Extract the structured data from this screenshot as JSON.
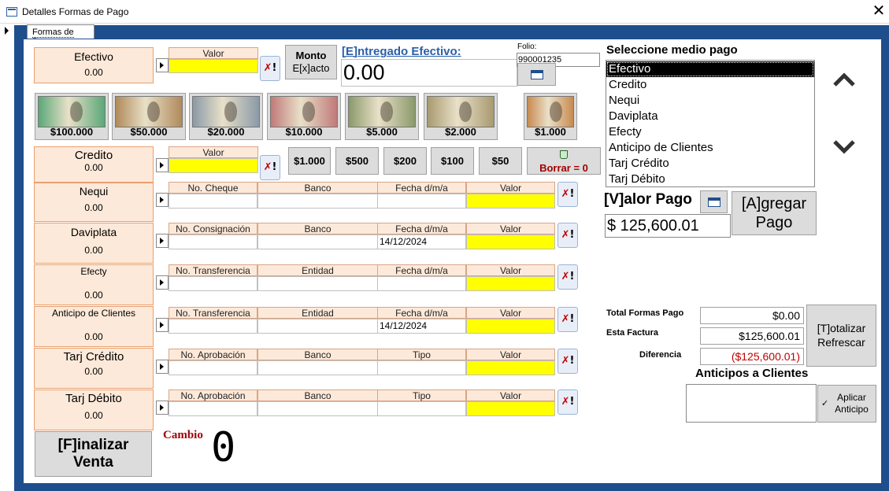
{
  "window": {
    "title": "Detalles Formas de Pago"
  },
  "tab": {
    "label": "Formas de Pago"
  },
  "efectivo": {
    "label": "Efectivo",
    "value": "0.00",
    "valor_header": "Valor"
  },
  "monto_exacto": {
    "line1": "Monto",
    "line2": "E[x]acto"
  },
  "entregado": {
    "label": "[E]ntregado Efectivo:",
    "value": "0.00"
  },
  "folio": {
    "label": "Folio:",
    "value": "990001235"
  },
  "bills": [
    {
      "label": "$100.000",
      "color": "#5aa878"
    },
    {
      "label": "$50.000",
      "color": "#b08a5a"
    },
    {
      "label": "$20.000",
      "color": "#8a9aa8"
    },
    {
      "label": "$10.000",
      "color": "#c07a7a"
    },
    {
      "label": "$5.000",
      "color": "#8a9a6a"
    },
    {
      "label": "$2.000",
      "color": "#a89a70"
    },
    {
      "label": "$1.000",
      "color": "#c88a50"
    }
  ],
  "methods": [
    {
      "label": "Credito",
      "value": "0.00"
    },
    {
      "label": "Nequi",
      "value": "0.00"
    },
    {
      "label": "Daviplata",
      "value": "0.00"
    },
    {
      "label": "Efecty",
      "value": "0.00"
    },
    {
      "label": "Anticipo de Clientes",
      "value": "0.00"
    },
    {
      "label": "Tarj Crédito",
      "value": "0.00"
    },
    {
      "label": "Tarj Débito",
      "value": "0.00"
    }
  ],
  "credito": {
    "valor_header": "Valor"
  },
  "coins": [
    "$1.000",
    "$500",
    "$200",
    "$100",
    "$50"
  ],
  "borrar": {
    "label": "Borrar = 0"
  },
  "rows": [
    {
      "c1": "No. Cheque",
      "c2": "Banco",
      "c3": "Fecha d/m/a",
      "c4": "Valor",
      "fecha": ""
    },
    {
      "c1": "No. Consignación",
      "c2": "Banco",
      "c3": "Fecha d/m/a",
      "c4": "Valor",
      "fecha": "14/12/2024"
    },
    {
      "c1": "No. Transferencia",
      "c2": "Entidad",
      "c3": "Fecha d/m/a",
      "c4": "Valor",
      "fecha": ""
    },
    {
      "c1": "No. Transferencia",
      "c2": "Entidad",
      "c3": "Fecha d/m/a",
      "c4": "Valor",
      "fecha": "14/12/2024"
    },
    {
      "c1": "No. Aprobación",
      "c2": "Banco",
      "c3": "Tipo",
      "c4": "Valor",
      "fecha": ""
    },
    {
      "c1": "No. Aprobación",
      "c2": "Banco",
      "c3": "Tipo",
      "c4": "Valor",
      "fecha": ""
    }
  ],
  "medio": {
    "title": "Seleccione medio pago",
    "items": [
      "Efectivo",
      "Credito",
      "Nequi",
      "Daviplata",
      "Efecty",
      "Anticipo de Clientes",
      "Tarj Crédito",
      "Tarj Débito"
    ],
    "selected": "Efectivo"
  },
  "valor_pago": {
    "label": "[V]alor Pago",
    "value": "$ 125,600.01"
  },
  "agregar": {
    "line1": "[A]gregar",
    "line2": "Pago"
  },
  "totals": {
    "total_label": "Total Formas Pago",
    "total_value": "$0.00",
    "factura_label": "Esta Factura",
    "factura_value": "$125,600.01",
    "diferencia_label": "Diferencia",
    "diferencia_value": "($125,600.01)"
  },
  "totalizar": {
    "line1": "[T]otalizar",
    "line2": "Refrescar"
  },
  "anticipos": {
    "title": "Anticipos a Clientes",
    "button_line1": "Aplicar",
    "button_line2": "Anticipo"
  },
  "finalizar": {
    "line1": "[F]inalizar",
    "line2": "Venta"
  },
  "cambio": {
    "label": "Cambio",
    "value": "0"
  }
}
